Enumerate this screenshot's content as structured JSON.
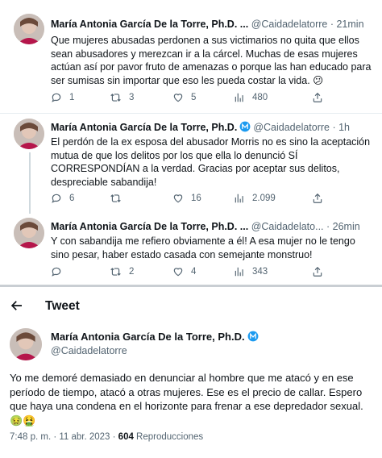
{
  "author": {
    "name": "María Antonia García De la Torre, Ph.D.",
    "name_truncated": "María Antonia García De la Torre, Ph.D. ...",
    "handle": "@Caidadelatorre",
    "handle_truncated": "@Caidadelato...",
    "avatar_icon": "profile-photo",
    "verified_icon": "verified-badge"
  },
  "thread": [
    {
      "name": "María Antonia García De la Torre, Ph.D. ...",
      "handle": "@Caidadelatorre",
      "time": "21min",
      "text": "Que mujeres abusadas perdonen a sus victimarios no quita que ellos sean abusadores y merezcan ir a la cárcel. Muchas de esas mujeres actúan así por pavor fruto de amenazas o porque las han educado para ser sumisas sin importar que eso les pueda costar la vida. 😕",
      "replies": "1",
      "retweets": "3",
      "likes": "5",
      "views": "480"
    },
    {
      "name": "María Antonia García De la Torre, Ph.D.",
      "handle": "@Caidadelatorre",
      "time": "1h",
      "text": "El perdón de la ex esposa del abusador Morris no es sino la aceptación mutua de que los delitos por los que ella lo denunció SÍ CORRESPONDÍAN a la verdad. Gracias por aceptar sus delitos, despreciable sabandija!",
      "replies": "6",
      "retweets": "",
      "likes": "16",
      "views": "2.099"
    },
    {
      "name": "María Antonia García De la Torre, Ph.D. ...",
      "handle": "@Caidadelato...",
      "time": "26min",
      "text": "Y con sabandija me refiero obviamente a él! A esa mujer no le tengo sino pesar, haber estado casada con semejante monstruo!",
      "replies": "",
      "retweets": "2",
      "likes": "4",
      "views": "343"
    }
  ],
  "header": {
    "back_icon": "arrow-left",
    "title": "Tweet"
  },
  "main_tweet": {
    "name": "María Antonia García De la Torre, Ph.D.",
    "handle": "@Caidadelatorre",
    "text": "Yo me demoré demasiado en denunciar al hombre que me atacó y en ese período de tiempo, atacó a otras mujeres. Ese es el precio de callar. Espero que haya una condena en el horizonte para frenar a ese depredador sexual. 🤢🤮",
    "timestamp": "7:48 p. m. · 11 abr. 2023 · ",
    "views_count": "604",
    "views_label": " Reproducciones"
  },
  "colors": {
    "text_primary": "#0f1419",
    "text_secondary": "#536471",
    "verified_blue": "#1d9bf0",
    "divider": "#e6ecf0"
  },
  "time_separator": " · "
}
